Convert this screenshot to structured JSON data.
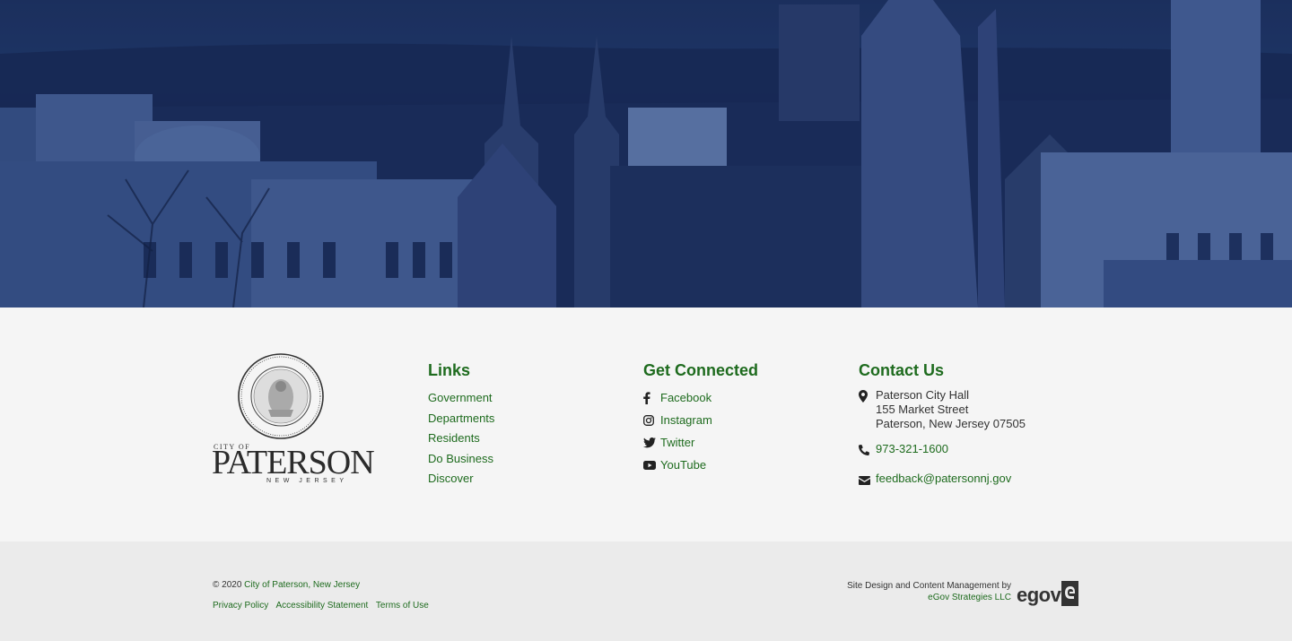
{
  "hero": {
    "image": "paterson-skyline"
  },
  "logo": {
    "seal_top": "CITY OF PATERSON",
    "seal_bottom": "FOUNDED 1792 NEW JERSEY",
    "small": "CITY OF",
    "name": "PATERSON",
    "state": "NEW JERSEY"
  },
  "links": {
    "title": "Links",
    "items": [
      "Government",
      "Departments",
      "Residents",
      "Do Business",
      "Discover"
    ]
  },
  "social": {
    "title": "Get Connected",
    "items": [
      {
        "label": "Facebook",
        "icon": "facebook-icon"
      },
      {
        "label": "Instagram",
        "icon": "instagram-icon"
      },
      {
        "label": "Twitter",
        "icon": "twitter-icon"
      },
      {
        "label": "YouTube",
        "icon": "youtube-icon"
      }
    ]
  },
  "contact": {
    "title": "Contact Us",
    "address": [
      "Paterson City Hall",
      "155 Market Street",
      "Paterson, New Jersey 07505"
    ],
    "phone": "973-321-1600",
    "email": "feedback@patersonnj.gov"
  },
  "bottom": {
    "copyright_prefix": "© 2020 ",
    "copyright_link": "City of Paterson, New Jersey",
    "legal": [
      "Privacy Policy",
      "Accessibility Statement",
      "Terms of Use"
    ],
    "credit_line": "Site Design and Content Management by",
    "credit_link": "eGov Strategies LLC",
    "egov_logo": "egov"
  },
  "colors": {
    "accent": "#1e6b1e",
    "hero": "#1b2f57",
    "footer_bg": "#f5f5f5",
    "bottom_bg": "#ebebeb"
  }
}
